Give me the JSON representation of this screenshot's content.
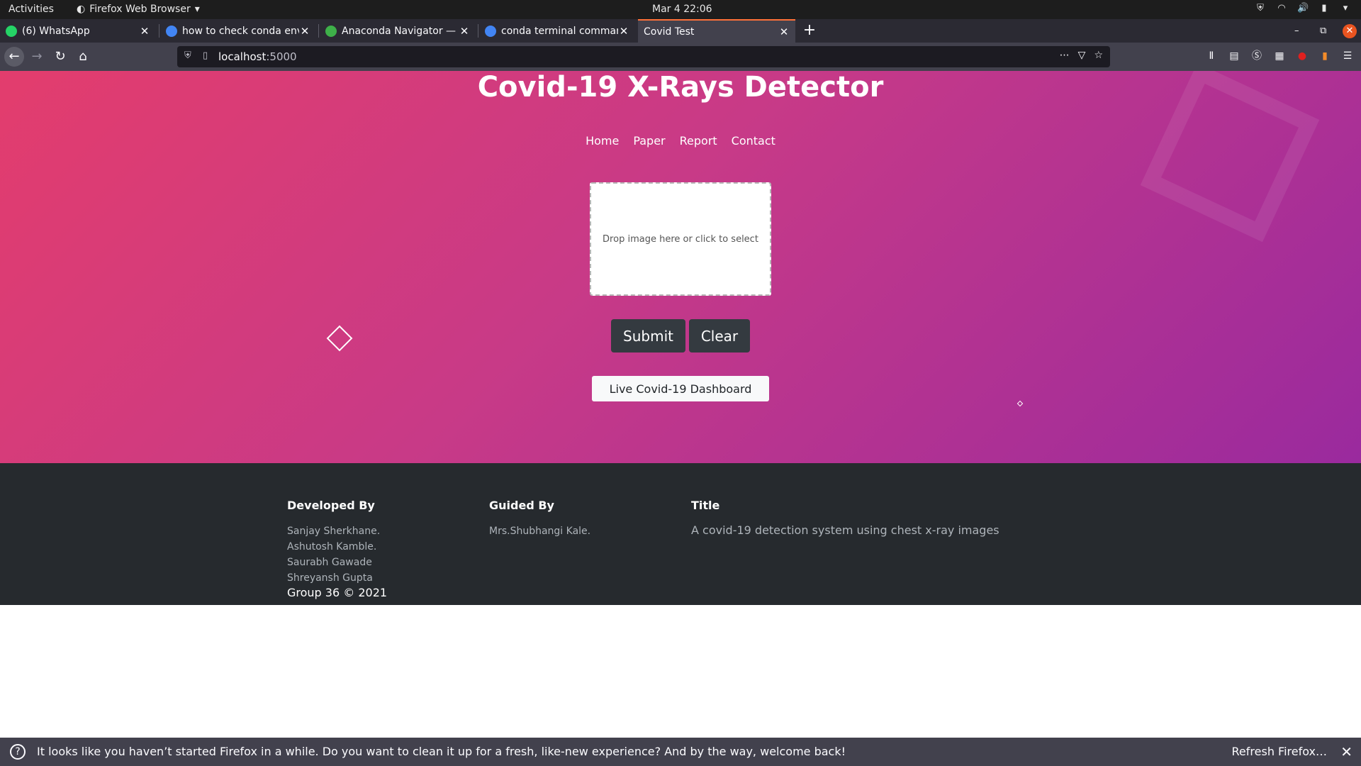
{
  "system_bar": {
    "activities": "Activities",
    "app_menu": "Firefox Web Browser",
    "clock": "Mar 4  22:06"
  },
  "tabs": [
    {
      "label": "(6) WhatsApp",
      "favicon_color": "#25d366"
    },
    {
      "label": "how to check conda env",
      "favicon_color": "#4285f4"
    },
    {
      "label": "Anaconda Navigator — A",
      "favicon_color": "#3eb049"
    },
    {
      "label": "conda terminal commanc",
      "favicon_color": "#4285f4"
    },
    {
      "label": "Covid Test",
      "favicon_color": "#42414d",
      "active": true
    }
  ],
  "address_bar": {
    "host": "localhost",
    "port": ":5000"
  },
  "page": {
    "title": "Covid-19 X-Rays Detector",
    "nav": [
      "Home",
      "Paper",
      "Report",
      "Contact"
    ],
    "dropzone_text": "Drop image here or click to select",
    "submit_label": "Submit",
    "clear_label": "Clear",
    "dashboard_label": "Live Covid-19 Dashboard",
    "gradient": [
      "#e33d6d",
      "#9a2a9e"
    ]
  },
  "footer": {
    "developed_heading": "Developed By",
    "developers": [
      "Sanjay Sherkhane.",
      "Ashutosh Kamble.",
      "Saurabh Gawade",
      "Shreyansh Gupta"
    ],
    "copyright": "Group 36 © 2021",
    "guided_heading": "Guided By",
    "guide": "Mrs.Shubhangi Kale.",
    "title_heading": "Title",
    "title_text": "A covid-19 detection system using chest x-ray images"
  },
  "notification": {
    "message": "It looks like you haven’t started Firefox in a while. Do you want to clean it up for a fresh, like-new experience? And by the way, welcome back!",
    "action": "Refresh Firefox…"
  }
}
